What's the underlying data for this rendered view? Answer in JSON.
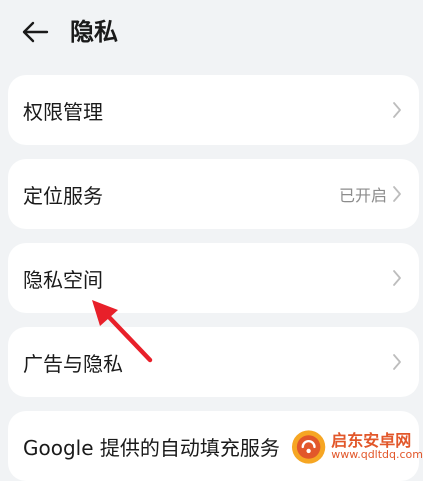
{
  "header": {
    "back_icon": "arrow-left-icon",
    "title": "隐私"
  },
  "items": [
    {
      "label": "权限管理",
      "value": ""
    },
    {
      "label": "定位服务",
      "value": "已开启"
    },
    {
      "label": "隐私空间",
      "value": ""
    },
    {
      "label": "广告与隐私",
      "value": ""
    },
    {
      "label": "Google 提供的自动填充服务",
      "value": ""
    }
  ],
  "annotation": {
    "icon": "red-arrow-icon",
    "color": "#e8202a"
  },
  "watermark": {
    "title": "启东安卓网",
    "url": "www.qdltdq.com",
    "color": "#e2572a"
  },
  "colors": {
    "background": "#f1f3f5",
    "card": "#ffffff",
    "secondary_text": "#8c8c8c"
  }
}
